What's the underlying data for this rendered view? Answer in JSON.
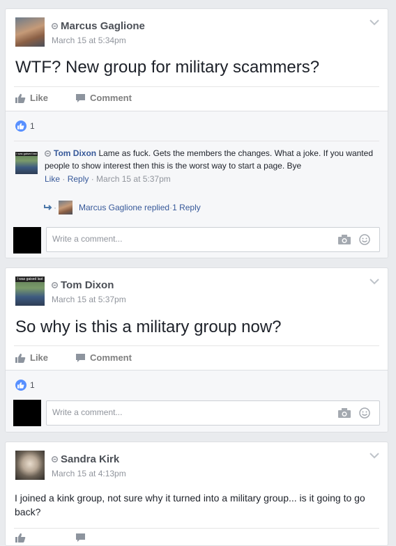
{
  "posts": [
    {
      "author": "Marcus Gaglione",
      "time": "March 15 at 5:34pm",
      "text": "WTF? New group for military scammers?",
      "like_label": "Like",
      "comment_label": "Comment",
      "like_count": "1",
      "comments": [
        {
          "author": "Tom Dixon",
          "text": "Lame as fuck. Gets the members the changes. What a joke. If you wanted people to show interest then this is the worst way to start a page. Bye",
          "like": "Like",
          "reply": "Reply",
          "time": "March 15 at 5:37pm",
          "reply_summary": "Marcus Gaglione replied",
          "reply_count": "1 Reply"
        }
      ],
      "comment_placeholder": "Write a comment..."
    },
    {
      "author": "Tom Dixon",
      "time": "March 15 at 5:37pm",
      "text": "So why is this a military group now?",
      "like_label": "Like",
      "comment_label": "Comment",
      "like_count": "1",
      "comment_placeholder": "Write a comment..."
    },
    {
      "author": "Sandra Kirk",
      "time": "March 15 at 4:13pm",
      "text": "I joined a kink group, not sure why it turned into a military group... is it going to go back?"
    }
  ],
  "sep": " · ",
  "avatar_banner_text": "I was gaised last one",
  "colors": {
    "link": "#365899",
    "like_badge": "#5890ff",
    "page_bg": "#e9ebee"
  }
}
